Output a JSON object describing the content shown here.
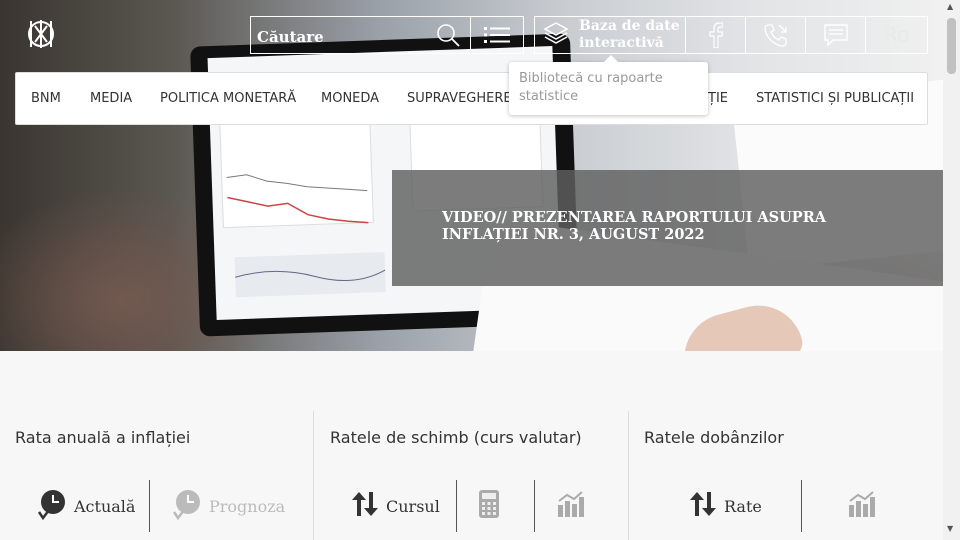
{
  "header": {
    "logo_icon": "bnm-logo-icon",
    "search": {
      "placeholder": "Căutare",
      "search_icon": "search-icon",
      "menu_icon": "list-menu-icon"
    },
    "database_button": {
      "label": "Baza de date interactivă",
      "icon": "layers-icon"
    },
    "facebook_icon": "facebook-icon",
    "phone_icon": "phone-icon",
    "feedback_icon": "chat-icon",
    "language": "Ro"
  },
  "tooltip": {
    "text": "Bibliotecă cu rapoarte statistice"
  },
  "nav": {
    "items": [
      {
        "label": "BNM"
      },
      {
        "label": "MEDIA"
      },
      {
        "label": "POLITICA MONETARĂ"
      },
      {
        "label": "MONEDA"
      },
      {
        "label": "SUPRAVEGHERE"
      },
      {
        "label": "ȚIE"
      },
      {
        "label": "STATISTICI ȘI PUBLICAȚII"
      }
    ]
  },
  "banner": {
    "text": "VIDEO// PREZENTAREA RAPORTULUI ASUPRA INFLAȚIEI NR. 3, AUGUST 2022"
  },
  "widgets": {
    "inflation": {
      "title": "Rata anuală a inflației",
      "current_label": "Actuală",
      "forecast_label": "Prognoza"
    },
    "exchange": {
      "title": "Ratele de schimb (curs valutar)",
      "rate_label": "Cursul"
    },
    "interest": {
      "title": "Ratele dobânzilor",
      "rate_label": "Rate"
    }
  },
  "colors": {
    "nav_bg": "#ffffff",
    "banner_bg": "#5f5f5f",
    "dim_text": "#bbbbbb"
  }
}
